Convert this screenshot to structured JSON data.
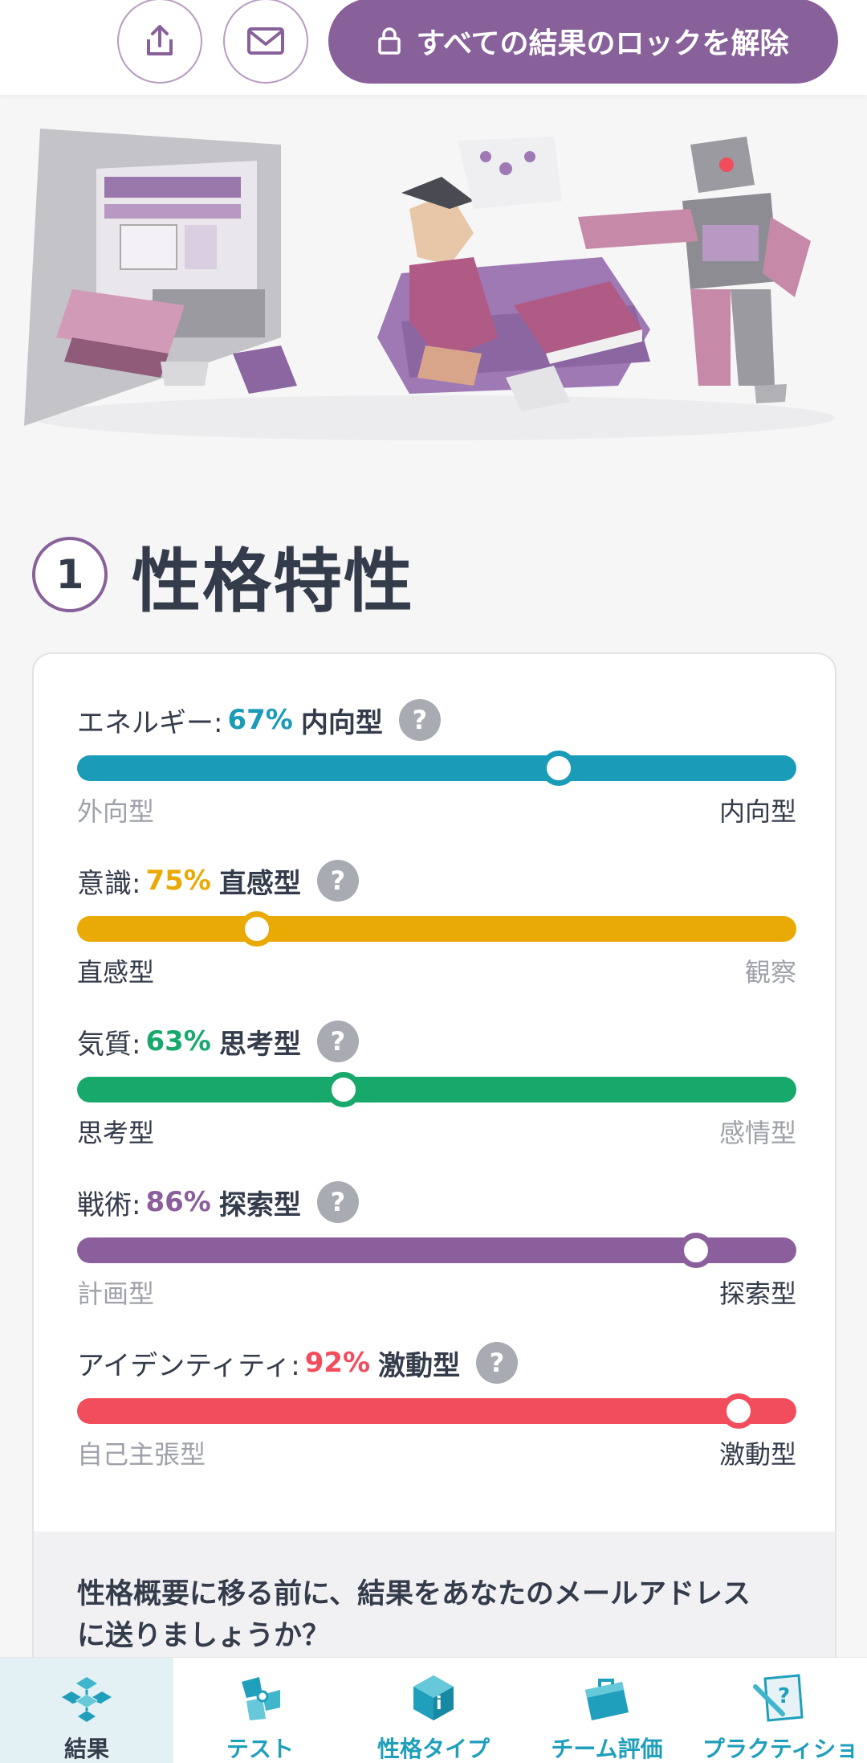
{
  "topbar": {
    "share_icon": "share-icon",
    "mail_icon": "mail-icon",
    "unlock_label": "すべての結果のロックを解除",
    "lock_icon": "lock-icon"
  },
  "section": {
    "number": "1",
    "title": "性格特性"
  },
  "traits": [
    {
      "label": "エネルギー:",
      "percent": "67%",
      "type": "内向型",
      "color": "#1a9bb7",
      "left": "外向型",
      "right": "内向型",
      "active_side": "right",
      "value": 67
    },
    {
      "label": "意識:",
      "percent": "75%",
      "type": "直感型",
      "color": "#e9aa05",
      "left": "直感型",
      "right": "観察",
      "active_side": "left",
      "value": 75
    },
    {
      "label": "気質:",
      "percent": "63%",
      "type": "思考型",
      "color": "#17a86c",
      "left": "思考型",
      "right": "感情型",
      "active_side": "left",
      "value": 63
    },
    {
      "label": "戦術:",
      "percent": "86%",
      "type": "探索型",
      "color": "#8b5e9c",
      "left": "計画型",
      "right": "探索型",
      "active_side": "right",
      "value": 86
    },
    {
      "label": "アイデンティティ:",
      "percent": "92%",
      "type": "激動型",
      "color": "#f24d5c",
      "left": "自己主張型",
      "right": "激動型",
      "active_side": "right",
      "value": 92
    }
  ],
  "email_prompt": {
    "line1": "性格概要に移る前に、結果をあなたのメールアドレス",
    "line2": "に送りましょうか？"
  },
  "nav": [
    {
      "label": "結果",
      "icon": "results-icon",
      "active": true
    },
    {
      "label": "テスト",
      "icon": "test-icon",
      "active": false
    },
    {
      "label": "性格タイプ",
      "icon": "personality-types-icon",
      "active": false
    },
    {
      "label": "チーム評価",
      "icon": "team-assessment-icon",
      "active": false
    },
    {
      "label": "プラクティショ",
      "icon": "practitioner-icon",
      "active": false
    }
  ]
}
